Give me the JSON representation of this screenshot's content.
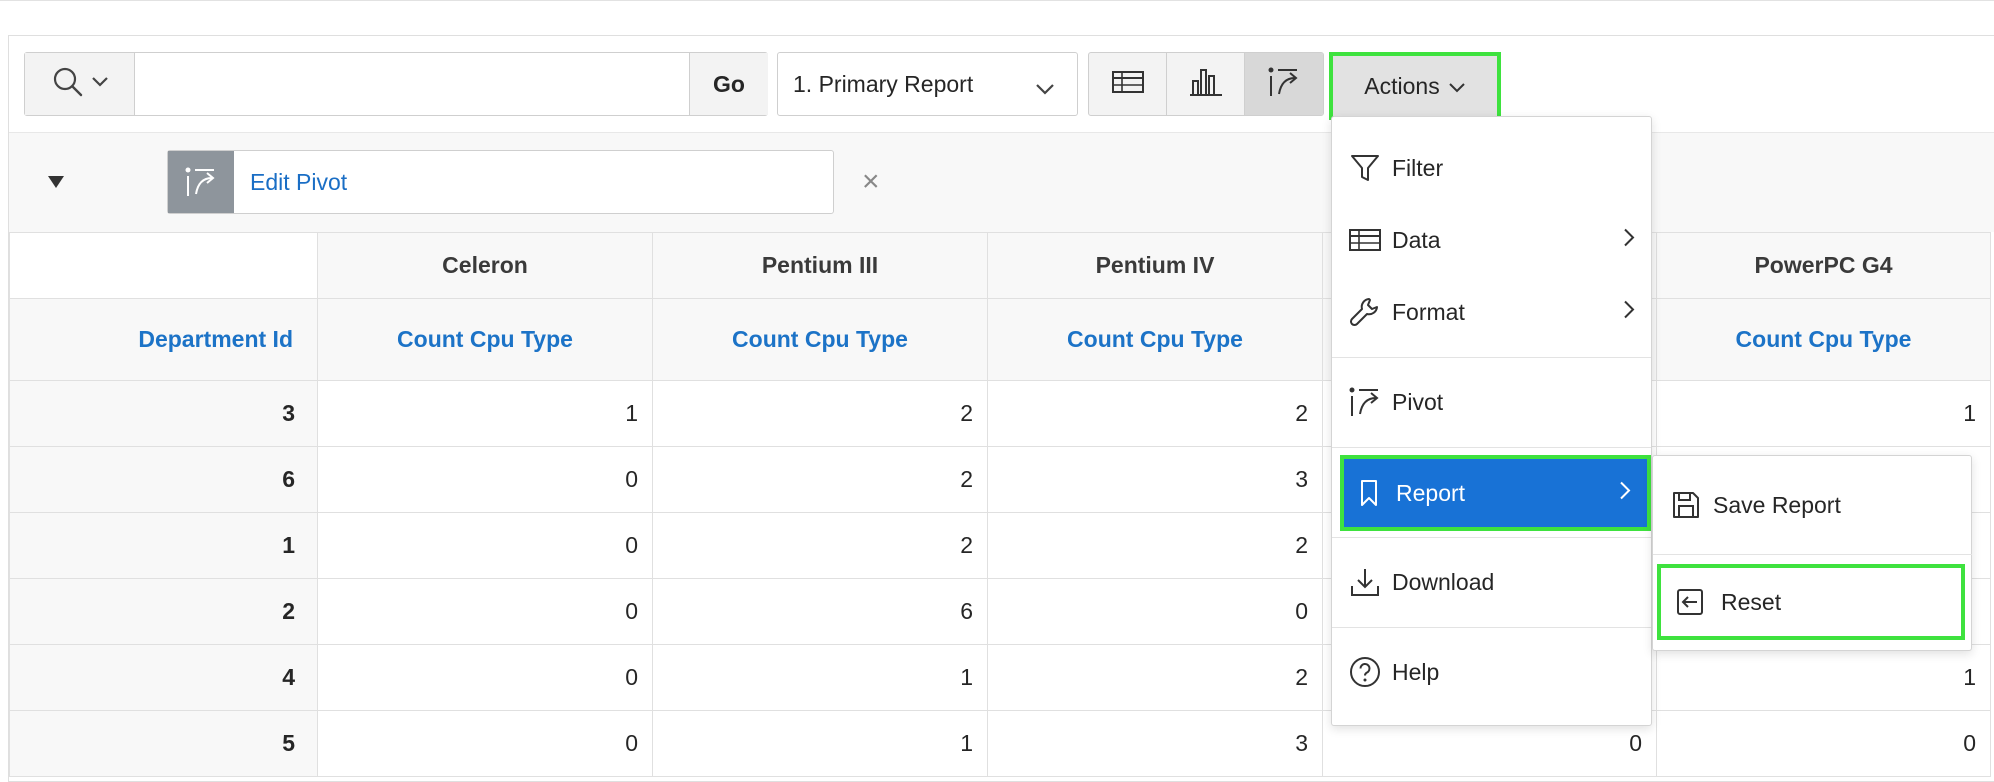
{
  "toolbar": {
    "search_placeholder": "",
    "go_label": "Go",
    "report_select_value": "1. Primary Report",
    "actions_label": "Actions"
  },
  "pivot": {
    "chip_label": "Edit Pivot",
    "remove_symbol": "×"
  },
  "table": {
    "pivot_columns": [
      "Celeron",
      "Pentium III",
      "Pentium IV",
      "PowerPC G4"
    ],
    "row_header": "Department Id",
    "measure_label": "Count Cpu Type",
    "rows": [
      {
        "dept": "3",
        "values": [
          "1",
          "2",
          "2",
          "1"
        ]
      },
      {
        "dept": "6",
        "values": [
          "0",
          "2",
          "3",
          ""
        ]
      },
      {
        "dept": "1",
        "values": [
          "0",
          "2",
          "2",
          ""
        ]
      },
      {
        "dept": "2",
        "values": [
          "0",
          "6",
          "0",
          ""
        ]
      },
      {
        "dept": "4",
        "values": [
          "0",
          "1",
          "2",
          "1"
        ]
      },
      {
        "dept": "5",
        "values": [
          "0",
          "1",
          "3",
          "0"
        ]
      }
    ],
    "hidden_col_last_value": "0"
  },
  "actions_menu": {
    "items": [
      {
        "label": "Filter",
        "icon": "filter-icon"
      },
      {
        "label": "Data",
        "icon": "table-icon",
        "submenu": true
      },
      {
        "label": "Format",
        "icon": "wrench-icon",
        "submenu": true
      },
      {
        "label": "Pivot",
        "icon": "pivot-icon"
      },
      {
        "label": "Report",
        "icon": "bookmark-icon",
        "submenu": true,
        "active": true
      },
      {
        "label": "Download",
        "icon": "download-icon"
      },
      {
        "label": "Help",
        "icon": "help-icon"
      }
    ]
  },
  "report_submenu": {
    "items": [
      {
        "label": "Save Report",
        "icon": "save-icon"
      },
      {
        "label": "Reset",
        "icon": "reset-icon"
      }
    ]
  },
  "colors": {
    "link_blue": "#1c73c7",
    "active_blue": "#1872d6",
    "highlight_green": "#3ee23e"
  }
}
